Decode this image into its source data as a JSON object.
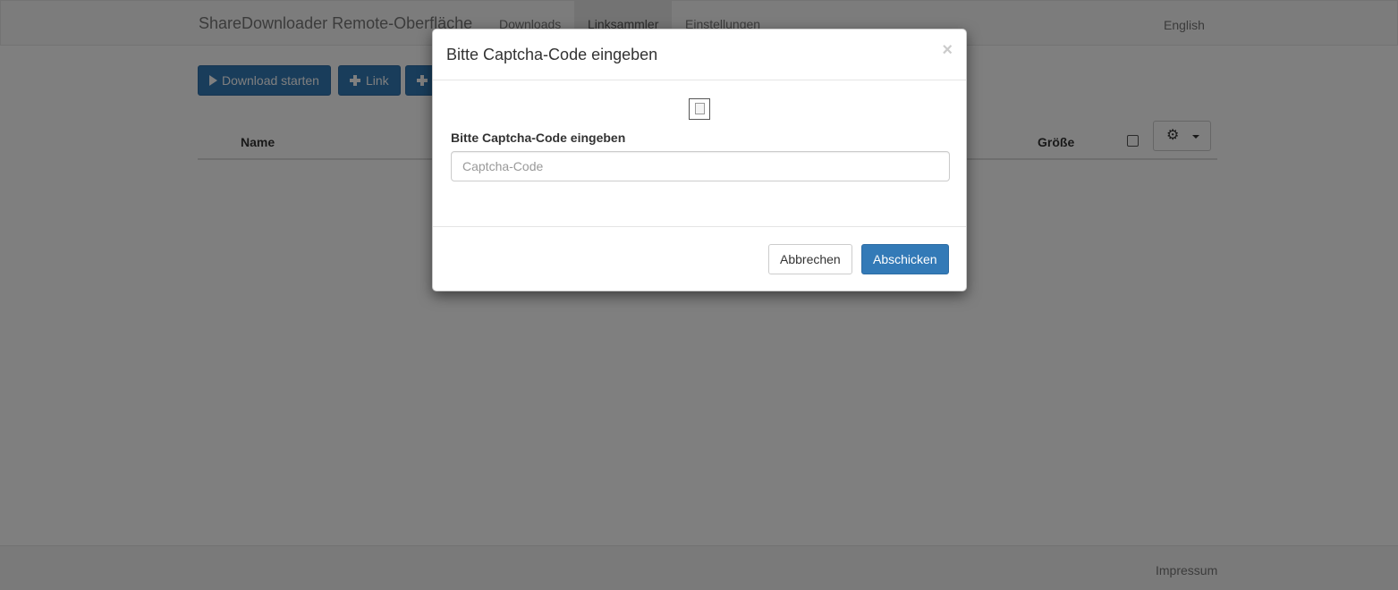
{
  "navbar": {
    "brand": "ShareDownloader Remote-Oberfläche",
    "items": [
      {
        "label": "Downloads",
        "active": false
      },
      {
        "label": "Linksammler",
        "active": true
      },
      {
        "label": "Einstellungen",
        "active": false
      }
    ],
    "language": "English"
  },
  "toolbar": {
    "download_start_label": "Download starten",
    "add_link_label": "Link",
    "add_more_label": ""
  },
  "table": {
    "columns": {
      "name": "Name",
      "size": "Größe"
    },
    "gear_icon": "gear-icon"
  },
  "footer": {
    "imprint": "Impressum"
  },
  "modal": {
    "title": "Bitte Captcha-Code eingeben",
    "close": "×",
    "field_label": "Bitte Captcha-Code eingeben",
    "input_placeholder": "Captcha-Code",
    "input_value": "",
    "cancel_label": "Abbrechen",
    "submit_label": "Abschicken"
  },
  "colors": {
    "primary": "#337ab7",
    "backdrop": "rgba(0,0,0,0.5)"
  }
}
